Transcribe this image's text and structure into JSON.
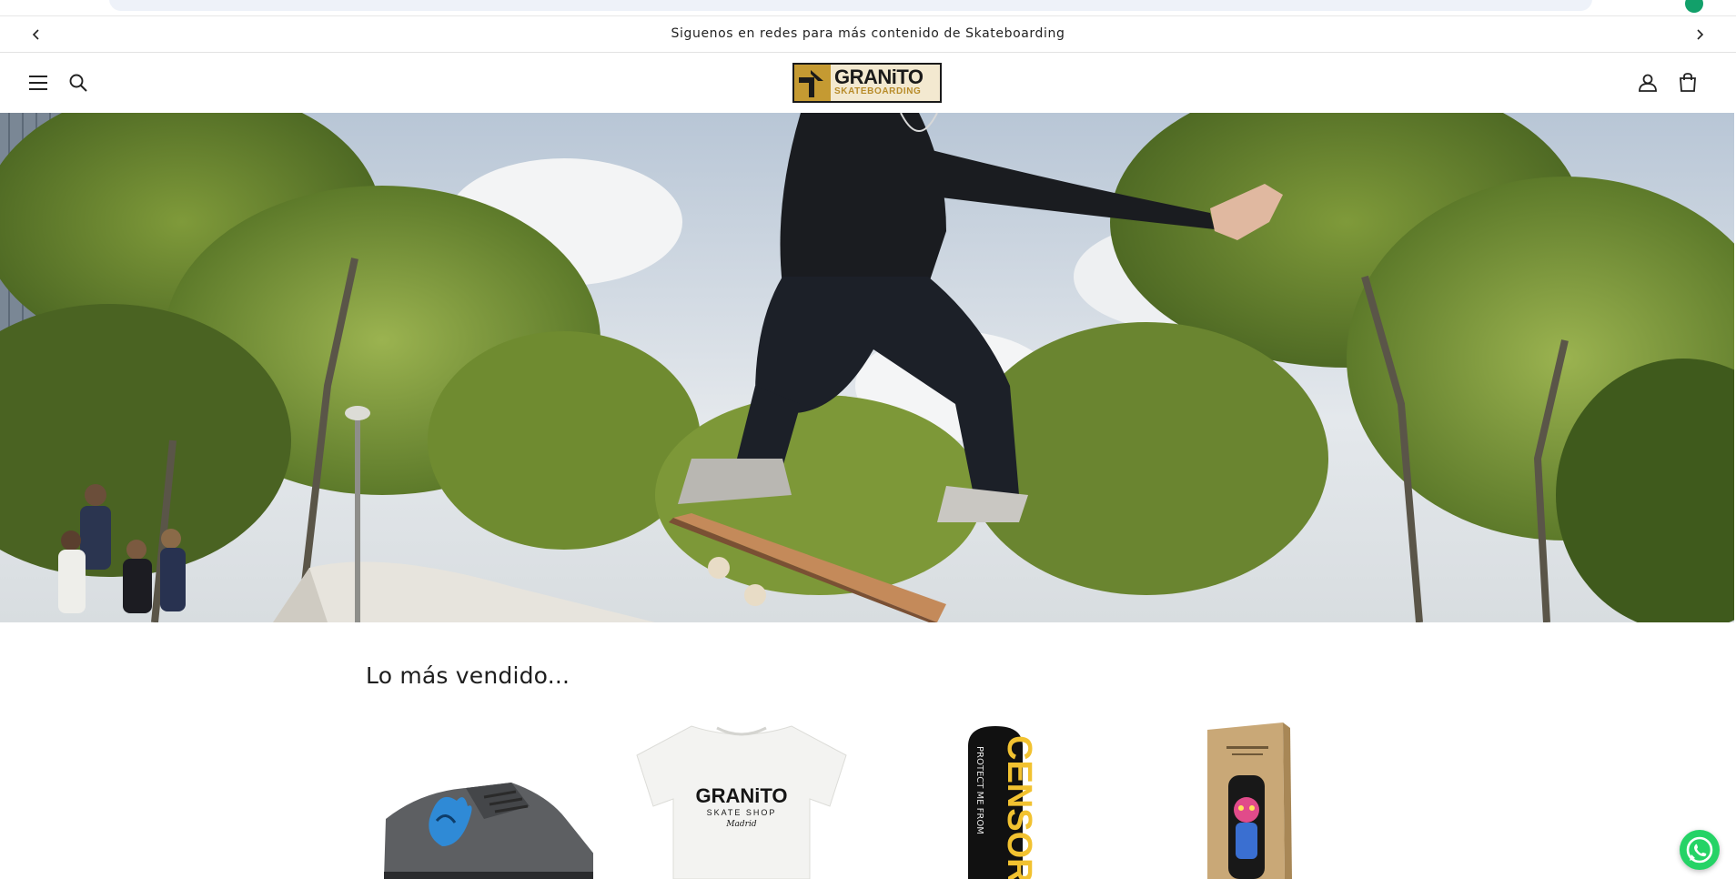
{
  "announcement": {
    "text": "Siguenos en redes para más contenido de Skateboarding",
    "prev_icon": "chevron-left-icon",
    "next_icon": "chevron-right-icon"
  },
  "header": {
    "menu_icon": "hamburger-menu-icon",
    "search_icon": "search-icon",
    "account_icon": "account-icon",
    "cart_icon": "cart-icon",
    "logo": {
      "main": "GRANiTO",
      "sub": "SKATEBOARDING"
    }
  },
  "bestsellers": {
    "title": "Lo más vendido...",
    "products": [
      {
        "graphic": "sneaker"
      },
      {
        "graphic": "tshirt",
        "print_main": "GRANiTO",
        "print_sub": "SKATE SHOP",
        "print_script": "Madrid"
      },
      {
        "graphic": "deck",
        "print_main": "CENSORS",
        "print_sub": "PROTECT ME FROM"
      },
      {
        "graphic": "boxed-deck"
      }
    ]
  },
  "colors": {
    "accent_gold": "#c59a32",
    "whatsapp": "#25d366"
  }
}
